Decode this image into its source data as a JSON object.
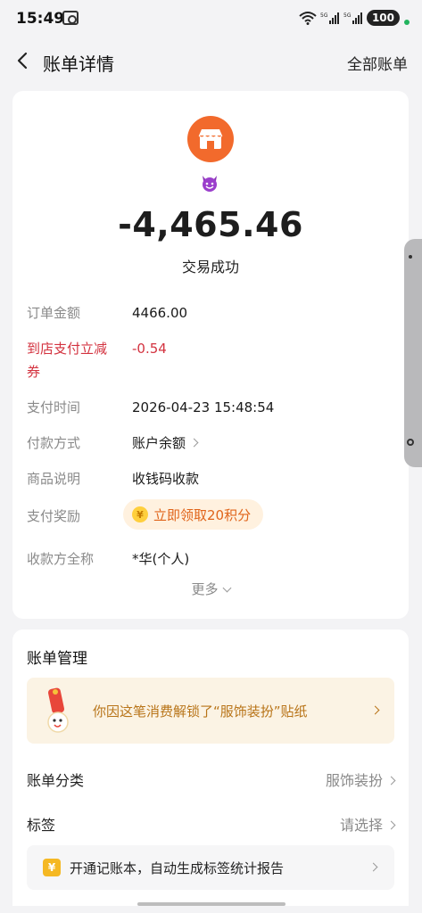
{
  "status_bar": {
    "time": "15:49",
    "battery": "100",
    "network_1": "5G",
    "network_2": "5G"
  },
  "nav": {
    "title": "账单详情",
    "right_link": "全部账单"
  },
  "summary": {
    "merchant_icon": "shop-icon",
    "emoji_icon": "devil-emoji-icon",
    "amount": "-4,465.46",
    "status": "交易成功",
    "colors": {
      "merchant_icon": "#f26a2c",
      "discount": "#d3323f",
      "reward": "#e0641a"
    }
  },
  "details": {
    "order_amount": {
      "label": "订单金额",
      "value": "4466.00"
    },
    "discount": {
      "label_line1": "到店支付立减",
      "label_line2": "券",
      "value": "-0.54"
    },
    "pay_time": {
      "label": "支付时间",
      "value": "2026-04-23 15:48:54"
    },
    "pay_method": {
      "label": "付款方式",
      "value": "账户余额"
    },
    "description": {
      "label": "商品说明",
      "value": "收钱码收款"
    },
    "reward": {
      "label": "支付奖励",
      "value": "立即领取20积分"
    },
    "payee": {
      "label": "收款方全称",
      "value": "*华(个人)"
    },
    "more": "更多"
  },
  "manage": {
    "title": "账单管理",
    "sticker_text": "你因这笔消费解锁了“服饰装扮”贴纸",
    "category": {
      "label": "账单分类",
      "value": "服饰装扮"
    },
    "tag": {
      "label": "标签",
      "value": "请选择"
    },
    "promo": "开通记账本，自动生成标签统计报告"
  }
}
